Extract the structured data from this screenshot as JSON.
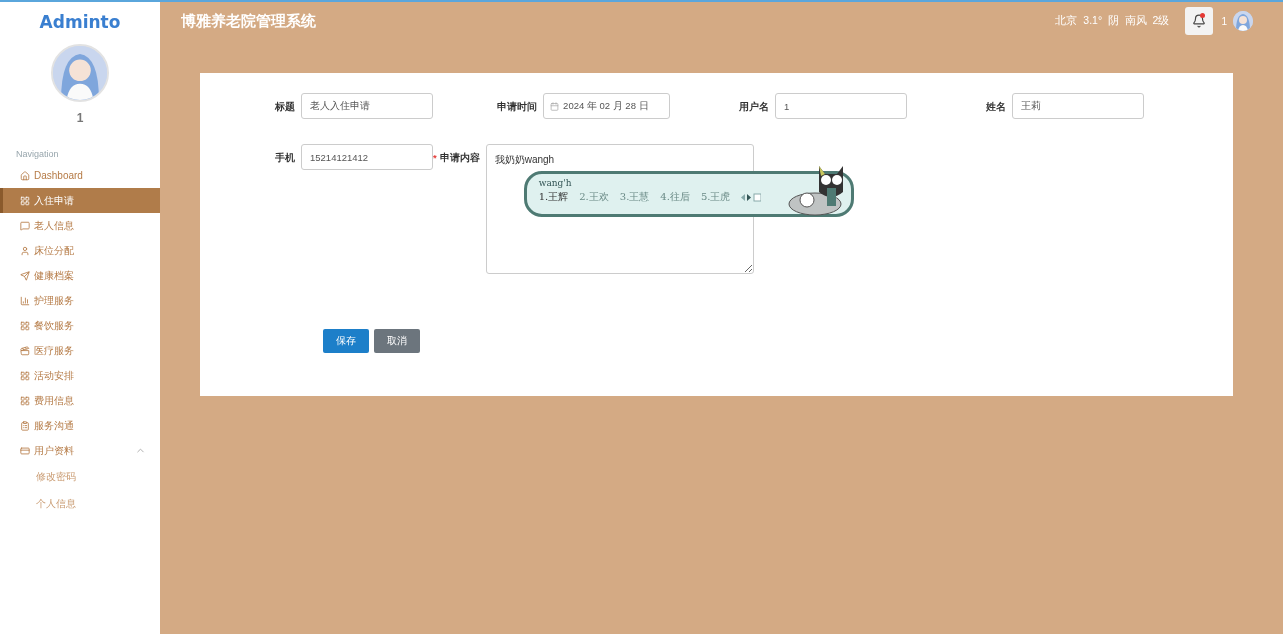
{
  "sidebar": {
    "logo": "Adminto",
    "user_name": "1",
    "section_title": "Navigation",
    "items": [
      {
        "label": "Dashboard",
        "selected": false
      },
      {
        "label": "入住申请",
        "selected": true
      },
      {
        "label": "老人信息",
        "selected": false
      },
      {
        "label": "床位分配",
        "selected": false
      },
      {
        "label": "健康档案",
        "selected": false
      },
      {
        "label": "护理服务",
        "selected": false
      },
      {
        "label": "餐饮服务",
        "selected": false
      },
      {
        "label": "医疗服务",
        "selected": false
      },
      {
        "label": "活动安排",
        "selected": false
      },
      {
        "label": "费用信息",
        "selected": false
      },
      {
        "label": "服务沟通",
        "selected": false
      },
      {
        "label": "用户资料",
        "selected": false,
        "expanded": true,
        "children": [
          {
            "label": "修改密码"
          },
          {
            "label": "个人信息"
          }
        ]
      }
    ]
  },
  "header": {
    "title": "博雅养老院管理系统",
    "weather": "北京  3.1°  阴  南风  2级",
    "user_name": "1"
  },
  "form": {
    "fields": [
      {
        "label": "标题",
        "value": "老人入住申请",
        "kind": "text",
        "required": false
      },
      {
        "label": "申请时间",
        "value": "2024 年 02 月 28 日",
        "kind": "date",
        "required": false
      },
      {
        "label": "用户名",
        "value": "1",
        "kind": "text",
        "required": false
      },
      {
        "label": "姓名",
        "value": "王莉",
        "kind": "text",
        "required": false
      },
      {
        "label": "手机",
        "value": "15214121412",
        "kind": "text",
        "required": false
      },
      {
        "label": "申请内容",
        "value": "我奶奶wangh",
        "kind": "textarea",
        "required": true
      }
    ],
    "required_mark": "*",
    "buttons": [
      {
        "label": "保存",
        "kind": "primary"
      },
      {
        "label": "取消",
        "kind": "secondary"
      }
    ]
  },
  "ime": {
    "composition": "wang'h",
    "candidates": [
      {
        "label": "1.王辉",
        "selected": true
      },
      {
        "label": "2.王欢",
        "selected": false
      },
      {
        "label": "3.王慧",
        "selected": false
      },
      {
        "label": "4.往后",
        "selected": false
      },
      {
        "label": "5.王虎",
        "selected": false
      }
    ]
  }
}
